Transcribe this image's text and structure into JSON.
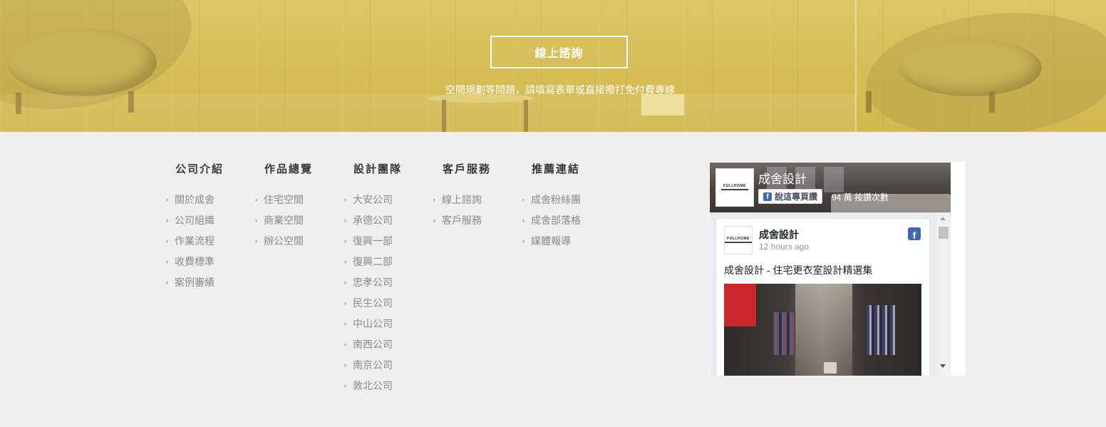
{
  "banner": {
    "cta_label": "線上諮詢",
    "cta_subtext": "空間規劃等問題，請填寫表單或直接撥打免付費專線"
  },
  "footer_nav": [
    {
      "heading": "公司介紹",
      "items": [
        "關於成舍",
        "公司組織",
        "作業流程",
        "收費標準",
        "案例審績"
      ]
    },
    {
      "heading": "作品總覽",
      "items": [
        "住宅空間",
        "商業空間",
        "辦公空間"
      ]
    },
    {
      "heading": "設計團隊",
      "items": [
        "大安公司",
        "承德公司",
        "復興一部",
        "復興二部",
        "忠孝公司",
        "民生公司",
        "中山公司",
        "南西公司",
        "南京公司",
        "敦北公司"
      ]
    },
    {
      "heading": "客戶服務",
      "items": [
        "線上諮詢",
        "客戶服務"
      ]
    },
    {
      "heading": "推薦連結",
      "items": [
        "成舍粉絲團",
        "成舍部落格",
        "媒體報導"
      ]
    }
  ],
  "facebook_widget": {
    "page_name": "成舍設計",
    "like_button_label": "說這專頁讚",
    "like_count_text": "94 萬 按讚次數",
    "logo_text": "FULLHOME",
    "post": {
      "author": "成舍設計",
      "time": "12 hours ago",
      "text": "成舍設計 - 住宅更衣室設計精選集"
    }
  }
}
